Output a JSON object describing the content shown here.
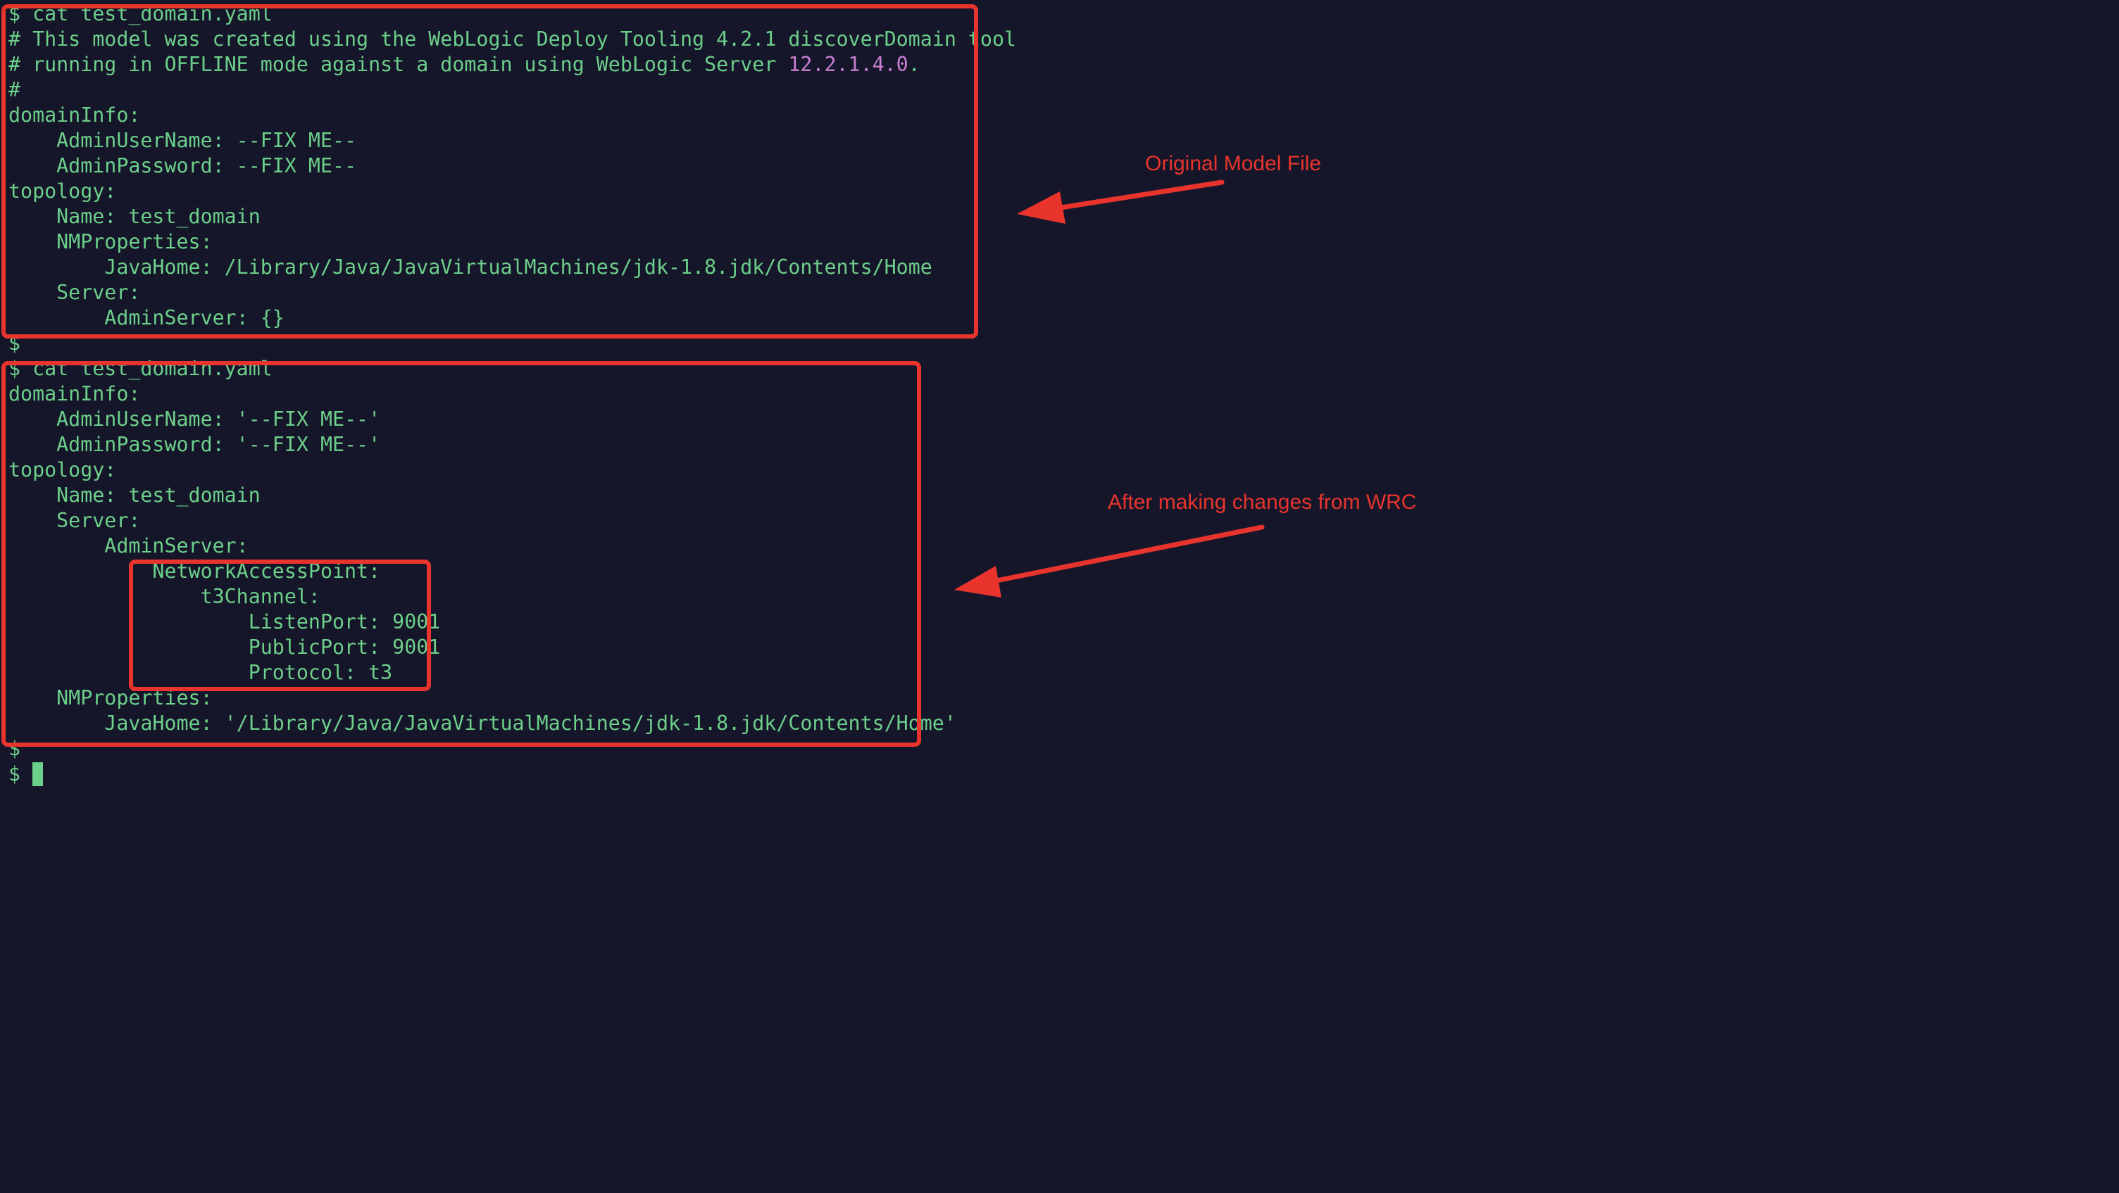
{
  "terminal": {
    "block1": {
      "prompt_line": "$ cat test_domain.yaml",
      "comment_1": "# This model was created using the WebLogic Deploy Tooling 4.2.1 discoverDomain tool",
      "comment_2_prefix": "# running in OFFLINE mode against a domain using WebLogic Server ",
      "comment_2_version": "12.2.1.4.0",
      "comment_2_suffix": ".",
      "comment_3": "#",
      "lines": [
        "domainInfo:",
        "    AdminUserName: --FIX ME--",
        "    AdminPassword: --FIX ME--",
        "topology:",
        "    Name: test_domain",
        "    NMProperties:",
        "        JavaHome: /Library/Java/JavaVirtualMachines/jdk-1.8.jdk/Contents/Home",
        "    Server:",
        "        AdminServer: {}"
      ]
    },
    "separator_prompt": "$",
    "block2": {
      "prompt_line": "$ cat test_domain.yaml",
      "lines": [
        "domainInfo:",
        "    AdminUserName: '--FIX ME--'",
        "    AdminPassword: '--FIX ME--'",
        "topology:",
        "    Name: test_domain",
        "    Server:",
        "        AdminServer:",
        "            NetworkAccessPoint:",
        "                t3Channel:",
        "                    ListenPort: 9001",
        "                    PublicPort: 9001",
        "                    Protocol: t3",
        "    NMProperties:",
        "        JavaHome: '/Library/Java/JavaVirtualMachines/jdk-1.8.jdk/Contents/Home'"
      ]
    },
    "after_prompt_1": "$",
    "after_prompt_2": "$ "
  },
  "annotations": {
    "original_label": "Original Model File",
    "after_label": "After making changes from WRC",
    "color": "#e8342d"
  },
  "colors": {
    "background": "#15162a",
    "text": "#6ccf8a",
    "number": "#c97ed1"
  }
}
